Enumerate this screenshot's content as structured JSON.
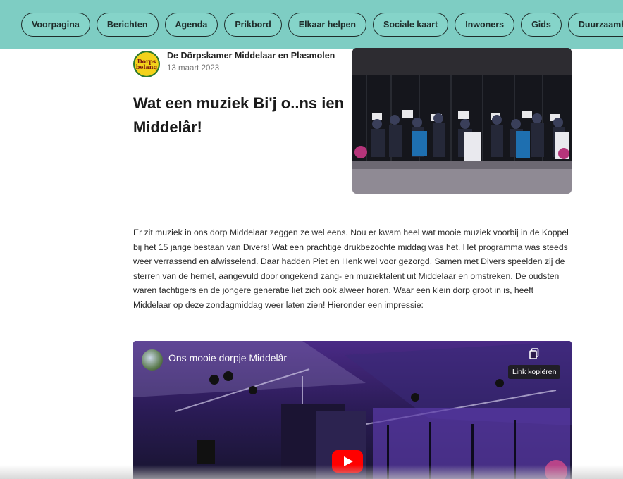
{
  "nav": {
    "items": [
      {
        "label": "Voorpagina"
      },
      {
        "label": "Berichten"
      },
      {
        "label": "Agenda"
      },
      {
        "label": "Prikbord"
      },
      {
        "label": "Elkaar helpen"
      },
      {
        "label": "Sociale kaart"
      },
      {
        "label": "Inwoners"
      },
      {
        "label": "Gids"
      },
      {
        "label": "Duurzaamheid"
      }
    ]
  },
  "post": {
    "logo_text_top": "Dorps",
    "logo_text_bottom": "belang",
    "author": "De Dörpskamer Middelaar en Plasmolen",
    "date": "13 maart 2023",
    "title": "Wat een muziek Bi'j o..ns ien Middelâr!",
    "body": "Er zit muziek in ons dorp Middelaar zeggen ze wel eens. Nou er kwam heel wat mooie muziek voorbij in de Koppel bij het 15 jarige bestaan van Divers! Wat een prachtige drukbezochte middag was het. Het programma was steeds weer verrassend en afwisselend. Daar hadden Piet en Henk wel voor gezorgd. Samen met Divers speelden zij de sterren van de hemel, aangevuld door ongekend zang- en muziektalent uit Middelaar en omstreken. De oudsten waren tachtigers en de jongere generatie liet zich ook alweer horen. Waar een klein dorp groot in is, heeft Middelaar op deze zondagmiddag weer laten zien! Hieronder een impressie:"
  },
  "video": {
    "title": "Ons mooie dorpje Middelâr",
    "copy_tooltip": "Link kopiëren"
  },
  "colors": {
    "nav_bg": "#7ecdc3",
    "play_red": "#ff0000"
  }
}
